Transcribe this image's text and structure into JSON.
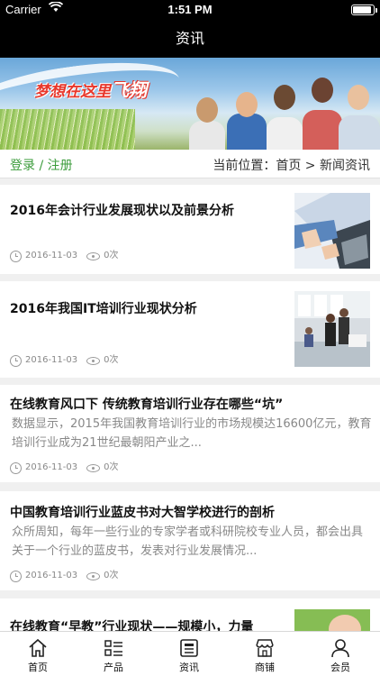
{
  "status_bar": {
    "carrier": "Carrier",
    "time": "1:51 PM"
  },
  "nav": {
    "title": "资讯"
  },
  "banner": {
    "slogan_small": "梦想在这里",
    "slogan_big": "飞翔"
  },
  "breadcrumb": {
    "auth": "登录 / 注册",
    "location": "当前位置：首页 > 新闻资讯"
  },
  "articles": [
    {
      "title": "2016年会计行业发展现状以及前景分析",
      "date": "2016-11-03",
      "views": "0次",
      "thumbnail": "laptop-hands"
    },
    {
      "title": "2016年我国IT培训行业现状分析",
      "date": "2016-11-03",
      "views": "0次",
      "thumbnail": "office-training"
    },
    {
      "title": "在线教育风口下 传统教育培训行业存在哪些“坑”",
      "summary": "数据显示，2015年我国教育培训行业的市场规模达16600亿元，教育培训行业成为21世纪最朝阳产业之...",
      "date": "2016-11-03",
      "views": "0次"
    },
    {
      "title": "中国教育培训行业蓝皮书对大智学校进行的剖析",
      "summary": "众所周知，每年一些行业的专家学者或科研院校专业人员，都会出具关于一个行业的蓝皮书，发表对行业发展情况...",
      "date": "2016-11-03",
      "views": "0次"
    },
    {
      "title": "在线教育“早教”行业现状——规模小，力量",
      "thumbnail": "child-portrait"
    }
  ],
  "tabs": [
    {
      "label": "首页",
      "icon": "home-icon"
    },
    {
      "label": "产品",
      "icon": "list-icon"
    },
    {
      "label": "资讯",
      "icon": "news-icon"
    },
    {
      "label": "商铺",
      "icon": "shop-icon"
    },
    {
      "label": "会员",
      "icon": "user-icon"
    }
  ]
}
